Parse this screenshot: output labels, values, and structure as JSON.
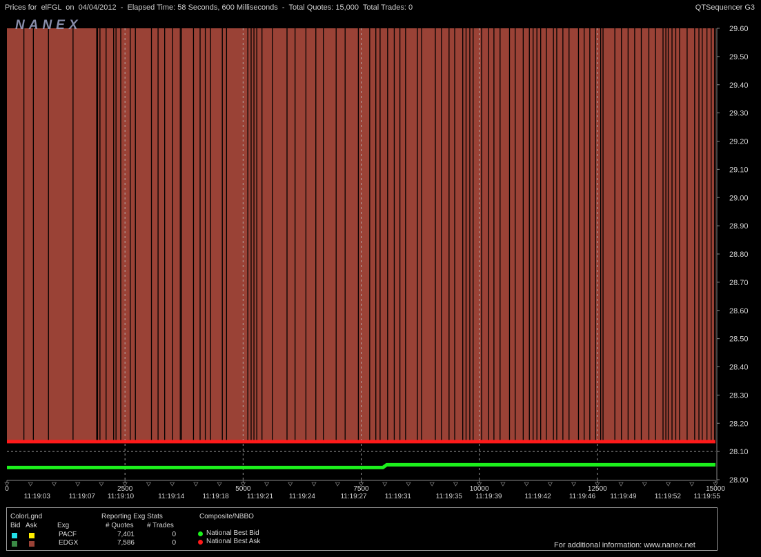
{
  "header": {
    "title": "Prices for  elFGL  on  04/04/2012  -  Elapsed Time: 58 Seconds, 600 Milliseconds  -  Total Quotes: 15,000  Total Trades: 0",
    "app_name": "QTSequencer G3"
  },
  "watermark": "NANEX",
  "colors": {
    "background": "#000000",
    "ask_fill": "#9a4236",
    "nbb": "#1cf01c",
    "nba": "#ff1a1a",
    "grid": "#bbbbbb",
    "text": "#d8d8d8"
  },
  "chart_data": {
    "type": "line",
    "title": "Prices for  elFGL  on  04/04/2012",
    "xlim": [
      0,
      15000
    ],
    "ylim": [
      28.0,
      29.6
    ],
    "x_ticks": [
      0,
      2500,
      5000,
      7500,
      10000,
      12500,
      15000
    ],
    "x_tick_labels": [
      "0",
      "2500",
      "5000",
      "7500",
      "10000",
      "12500",
      "15000"
    ],
    "y_ticks": [
      28.0,
      28.1,
      28.2,
      28.3,
      28.4,
      28.5,
      28.6,
      28.7,
      28.8,
      28.9,
      29.0,
      29.1,
      29.2,
      29.3,
      29.4,
      29.5,
      29.6
    ],
    "y_tick_labels": [
      "28.00",
      "28.10",
      "28.20",
      "28.30",
      "28.40",
      "28.50",
      "28.60",
      "28.70",
      "28.80",
      "28.90",
      "29.00",
      "29.10",
      "29.20",
      "29.30",
      "29.40",
      "29.50",
      "29.60"
    ],
    "time_labels": [
      "11:19:03",
      "11:19:07",
      "11:19:10",
      "11:19:14",
      "11:19:18",
      "11:19:21",
      "11:19:24",
      "11:19:27",
      "11:19:31",
      "11:19:35",
      "11:19:39",
      "11:19:42",
      "11:19:46",
      "11:19:49",
      "11:19:52",
      "11:19:55"
    ],
    "time_label_x": [
      640,
      1590,
      2410,
      3480,
      4420,
      5360,
      6250,
      7340,
      8280,
      9360,
      10200,
      11240,
      12180,
      13050,
      13990,
      14820
    ],
    "series": [
      {
        "name": "National Best Bid",
        "x": [
          0,
          7960,
          8040,
          15000
        ],
        "y": [
          28.043,
          28.043,
          28.053,
          28.053
        ]
      },
      {
        "name": "National Best Ask",
        "x": [
          0,
          15000
        ],
        "y": [
          28.135,
          28.135
        ]
      }
    ],
    "ask_band": {
      "low": 28.135,
      "high": 29.6
    },
    "ask_gaps_x": [
      360,
      560,
      880,
      1400,
      1900,
      1920,
      1970,
      2100,
      2260,
      2310,
      2410,
      2610,
      2720,
      3060,
      3200,
      3340,
      3510,
      3670,
      3700,
      3950,
      4090,
      4200,
      4310,
      4560,
      4650,
      5100,
      5170,
      5230,
      5290,
      5400,
      5620,
      5930,
      6100,
      6330,
      6540,
      6700,
      6970,
      7160,
      7440,
      7680,
      7810,
      7900,
      8060,
      8200,
      8320,
      8440,
      8690,
      8780,
      9070,
      9200,
      9360,
      9480,
      9650,
      9720,
      9800,
      9870,
      10050,
      10200,
      10310,
      10440,
      10640,
      10760,
      10930,
      11060,
      11140,
      11220,
      11300,
      11420,
      11570,
      11640,
      11770,
      11900,
      12100,
      12220,
      12340,
      12460,
      12570,
      12620,
      12870,
      13010,
      13150,
      13290,
      13430,
      13590,
      13730,
      13890,
      13950,
      14000,
      14080,
      14160,
      14240,
      14400,
      14560,
      14650,
      14720,
      14820,
      14910,
      14980
    ]
  },
  "legend": {
    "color_legend_title": "ColorLgnd",
    "bid_label": "Bid",
    "ask_label": "Ask",
    "exch_label": "Exg",
    "stats_title": "Reporting Exg Stats",
    "quotes_label": "# Quotes",
    "trades_label": "# Trades",
    "composite_title": "Composite/NBBO",
    "rows": [
      {
        "exchange": "PACF",
        "bid_color": "#22e0e8",
        "ask_color": "#ffee00",
        "quotes": "7,401",
        "trades": "0"
      },
      {
        "exchange": "EDGX",
        "bid_color": "#3a8a45",
        "ask_color": "#9a4236",
        "quotes": "7,586",
        "trades": "0"
      }
    ],
    "nbbo": [
      {
        "label": "National Best Bid",
        "color": "#1cf01c"
      },
      {
        "label": "National Best Ask",
        "color": "#ff1a1a"
      }
    ],
    "footer": "For additional information: www.nanex.net"
  }
}
